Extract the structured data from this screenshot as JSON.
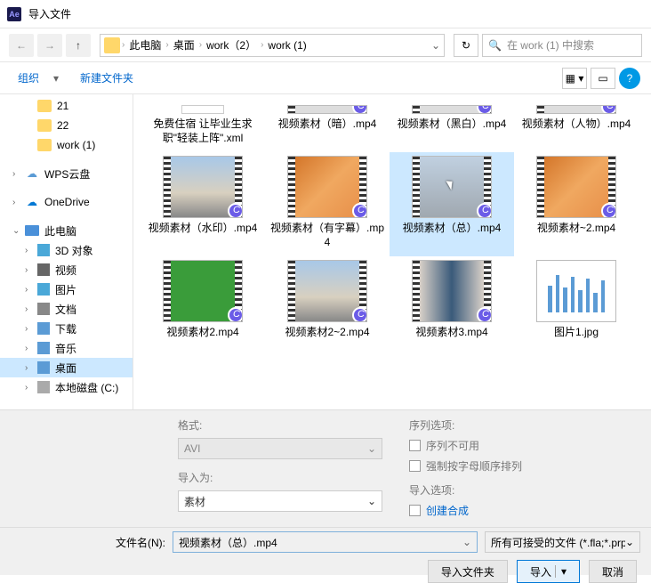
{
  "title": "导入文件",
  "breadcrumb": [
    "此电脑",
    "桌面",
    "work（2）",
    "work (1)"
  ],
  "search_placeholder": "在 work (1) 中搜索",
  "toolbar": {
    "organize": "组织",
    "newfolder": "新建文件夹"
  },
  "sidebar": {
    "folders": [
      "21",
      "22",
      "work (1)"
    ],
    "wps": "WPS云盘",
    "onedrive": "OneDrive",
    "thispc": "此电脑",
    "pc_items": [
      "3D 对象",
      "视频",
      "图片",
      "文档",
      "下载",
      "音乐",
      "桌面"
    ],
    "local_disk": "本地磁盘 (C:)"
  },
  "files": [
    {
      "name": "免费住宿 让毕业生求职\"轻装上阵\".xml",
      "type": "xml"
    },
    {
      "name": "视频素材（暗）.mp4",
      "type": "video"
    },
    {
      "name": "视频素材（黑白）.mp4",
      "type": "video"
    },
    {
      "name": "视频素材（人物）.mp4",
      "type": "video"
    },
    {
      "name": "视频素材（水印）.mp4",
      "type": "video",
      "thumb": "city"
    },
    {
      "name": "视频素材（有字幕）.mp4",
      "type": "video",
      "thumb": "leaves"
    },
    {
      "name": "视频素材（总）.mp4",
      "type": "video",
      "thumb": "person",
      "selected": true
    },
    {
      "name": "视频素材~2.mp4",
      "type": "video",
      "thumb": "leaves"
    },
    {
      "name": "视频素材2.mp4",
      "type": "video",
      "thumb": "green"
    },
    {
      "name": "视频素材2~2.mp4",
      "type": "video",
      "thumb": "city"
    },
    {
      "name": "视频素材3.mp4",
      "type": "video",
      "thumb": "eye"
    },
    {
      "name": "图片1.jpg",
      "type": "image",
      "thumb": "chart"
    }
  ],
  "options": {
    "format_label": "格式:",
    "format_value": "AVI",
    "importas_label": "导入为:",
    "importas_value": "素材",
    "seq_label": "序列选项:",
    "seq_unavailable": "序列不可用",
    "force_alpha": "强制按字母顺序排列",
    "import_opts_label": "导入选项:",
    "create_comp": "创建合成"
  },
  "footer": {
    "filename_label": "文件名(N):",
    "filename_value": "视频素材（总）.mp4",
    "filter": "所有可接受的文件 (*.fla;*.prpr",
    "import_folder": "导入文件夹",
    "import": "导入",
    "cancel": "取消"
  }
}
